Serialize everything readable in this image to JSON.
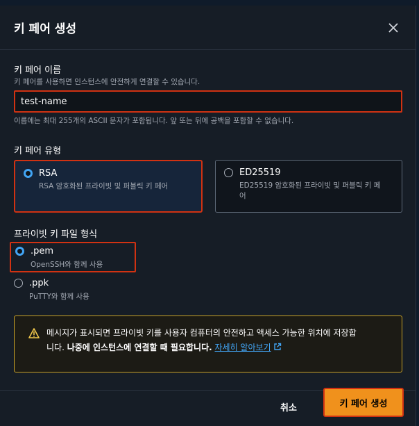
{
  "dialog": {
    "title": "키 페어 생성"
  },
  "name_field": {
    "label": "키 페어 이름",
    "description": "키 페어를 사용하면 인스턴스에 안전하게 연결할 수 있습니다.",
    "value": "test-name",
    "hint": "이름에는 최대 255개의 ASCII 문자가 포함됩니다. 앞 또는 뒤에 공백을 포함할 수 없습니다."
  },
  "key_type": {
    "label": "키 페어 유형",
    "options": [
      {
        "title": "RSA",
        "description": "RSA 암호화된 프라이빗 및 퍼블릭 키 페어",
        "selected": true
      },
      {
        "title": "ED25519",
        "description": "ED25519 암호화된 프라이빗 및 퍼블릭 키 페어",
        "selected": false
      }
    ]
  },
  "file_format": {
    "label": "프라이빗 키 파일 형식",
    "options": [
      {
        "title": ".pem",
        "description": "OpenSSH와 함께 사용",
        "selected": true
      },
      {
        "title": ".ppk",
        "description": "PuTTY와 함께 사용",
        "selected": false
      }
    ]
  },
  "warning": {
    "icon": "warning-icon",
    "text_line1": "메시지가 표시되면 프라이빗 키를 사용자 컴퓨터의 안전하고 액세스 가능한 위치에 저장합",
    "text_prefix": "니다. ",
    "text_bold": "나중에 인스턴스에 연결할 때 필요합니다.",
    "link": "자세히 알아보기"
  },
  "footer": {
    "cancel_label": "취소",
    "submit_label": "키 페어 생성"
  },
  "colors": {
    "accent": "#f0911c",
    "highlight": "#d13212",
    "link": "#42a5f5",
    "warning": "#c9a227"
  }
}
